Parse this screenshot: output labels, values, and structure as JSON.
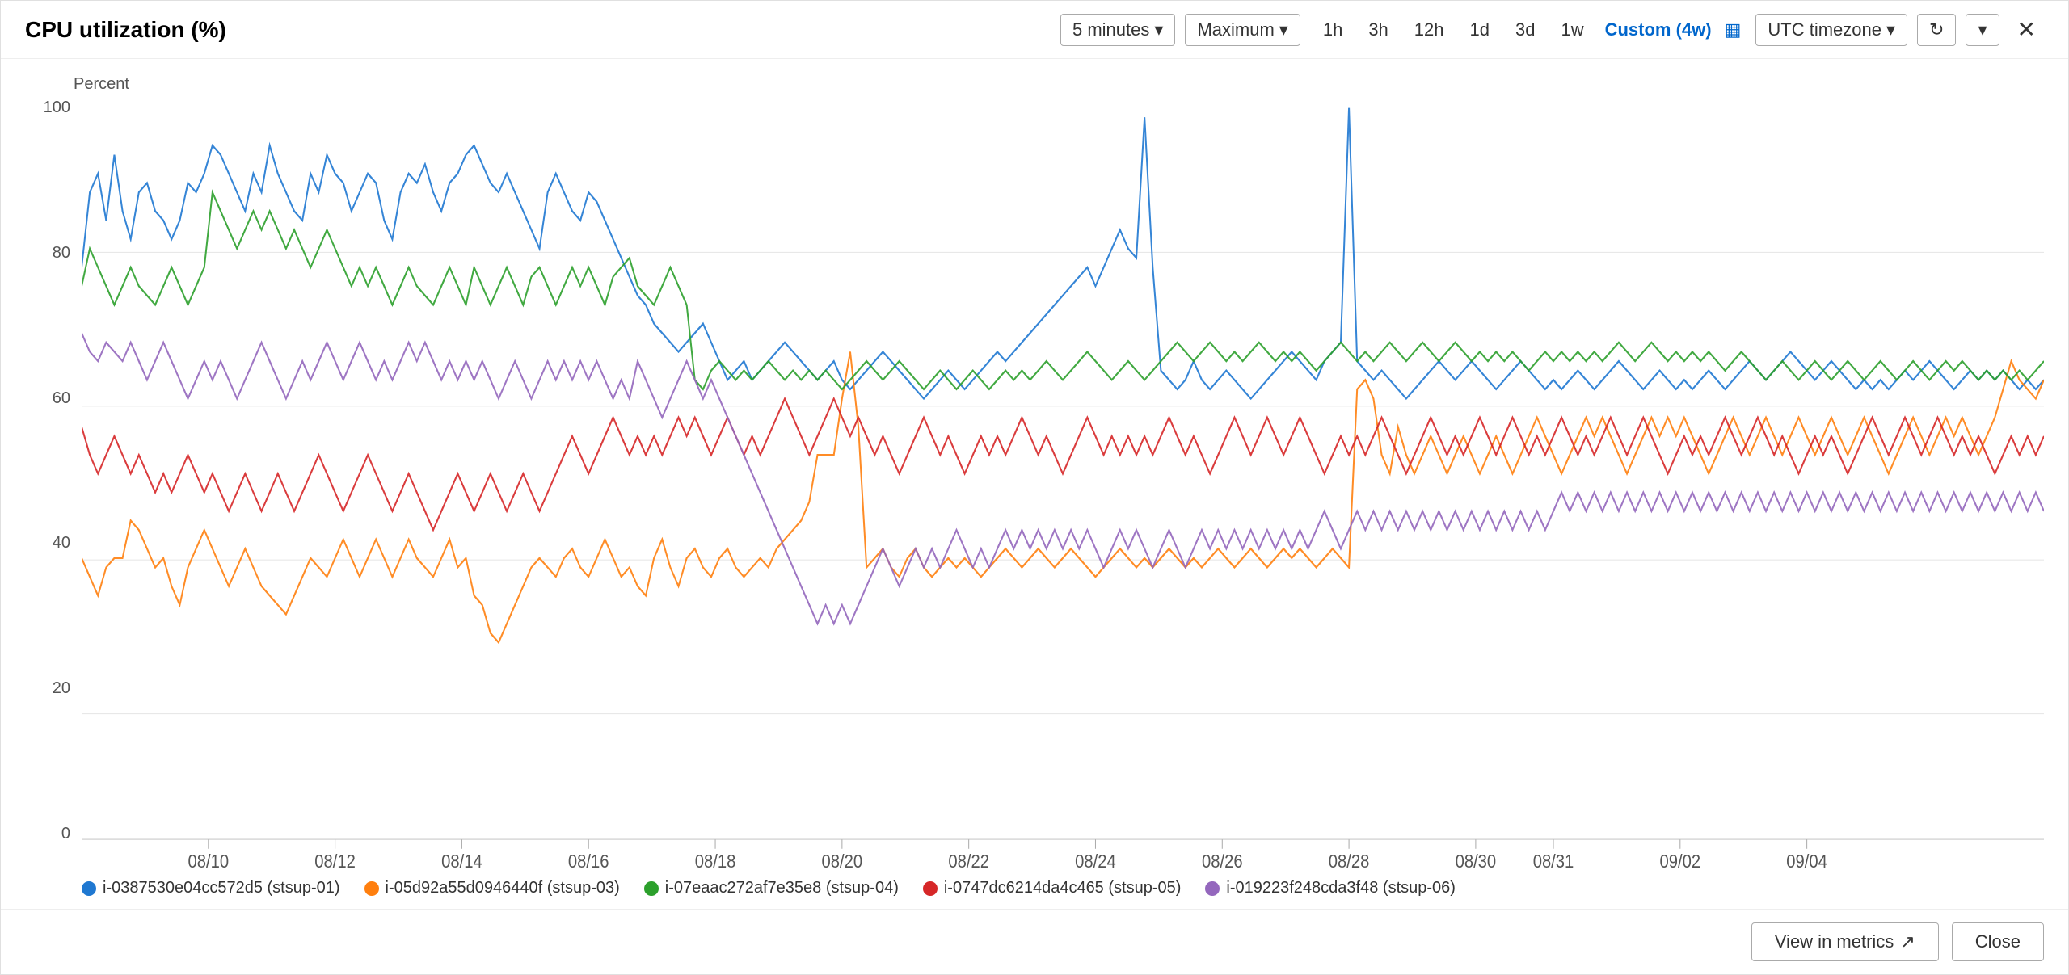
{
  "header": {
    "title": "CPU utilization (%)",
    "interval_label": "5 minutes",
    "stat_label": "Maximum",
    "time_ranges": [
      "1h",
      "3h",
      "12h",
      "1d",
      "3d",
      "1w"
    ],
    "custom_label": "Custom (4w)",
    "timezone_label": "UTC timezone",
    "refresh_icon": "↻",
    "dropdown_icon": "▾",
    "close_icon": "✕"
  },
  "chart": {
    "y_axis_label": "Percent",
    "y_ticks": [
      "100",
      "80",
      "60",
      "40",
      "20",
      "0"
    ],
    "x_ticks": [
      "08/10",
      "08/12",
      "08/14",
      "08/16",
      "08/18",
      "08/20",
      "08/22",
      "08/24",
      "08/26",
      "08/28",
      "08/30",
      "08/31",
      "09/02",
      "09/04"
    ]
  },
  "legend": {
    "items": [
      {
        "id": "i1",
        "color": "#1f78d1",
        "label": "i-0387530e04cc572d5 (stsup-01)"
      },
      {
        "id": "i2",
        "color": "#ff7f0e",
        "label": "i-05d92a55d0946440f (stsup-03)"
      },
      {
        "id": "i3",
        "color": "#2ca02c",
        "label": "i-07eaac272af7e35e8 (stsup-04)"
      },
      {
        "id": "i4",
        "color": "#d62728",
        "label": "i-0747dc6214da4c465 (stsup-05)"
      },
      {
        "id": "i5",
        "color": "#9467bd",
        "label": "i-019223f248cda3f48 (stsup-06)"
      }
    ]
  },
  "footer": {
    "view_metrics_label": "View in metrics",
    "close_label": "Close",
    "external_link_icon": "↗"
  }
}
